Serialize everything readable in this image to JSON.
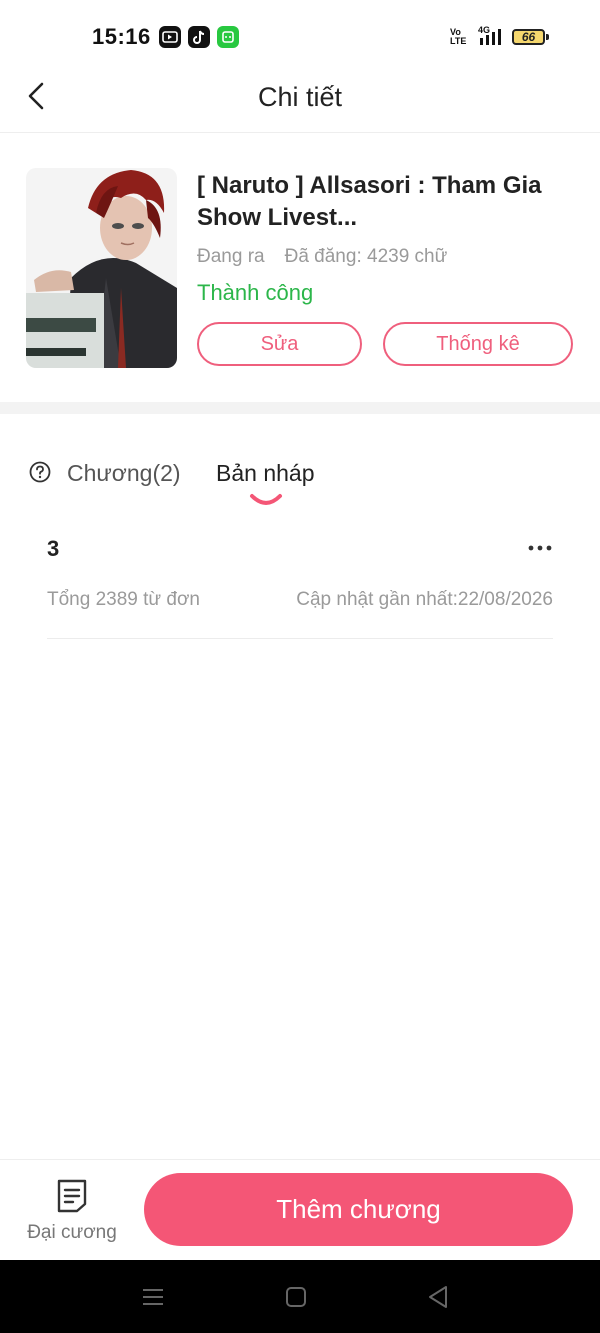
{
  "status_bar": {
    "time": "15:16",
    "network": "4G",
    "volte": "Vo LTE",
    "battery": "66",
    "app_icons": [
      "video-app-icon",
      "tiktok-icon",
      "messenger-app-icon"
    ]
  },
  "header": {
    "title": "Chi tiết",
    "back_icon": "chevron-left-icon"
  },
  "story": {
    "title": "[ Naruto ] Allsasori : Tham Gia Show Livest...",
    "status": "Đang ra",
    "posted_count": "Đã đăng: 4239 chữ",
    "review_state": "Thành công",
    "edit_button": "Sửa",
    "stats_button": "Thống kê"
  },
  "tabs": {
    "help_icon": "question-circle-icon",
    "chapters": "Chương(2)",
    "drafts": "Bản nháp",
    "active": "drafts"
  },
  "drafts": [
    {
      "title": "3",
      "words": "Tổng 2389 từ đơn",
      "updated": "Cập nhật gần nhất:22/08/2026"
    }
  ],
  "bottom_bar": {
    "outline_label": "Đại cương",
    "add_chapter_label": "Thêm chương"
  },
  "colors": {
    "accent": "#f45676",
    "accent_outline": "#ef5f7d",
    "success": "#2cb64a",
    "muted_text": "#9a9a9a"
  }
}
